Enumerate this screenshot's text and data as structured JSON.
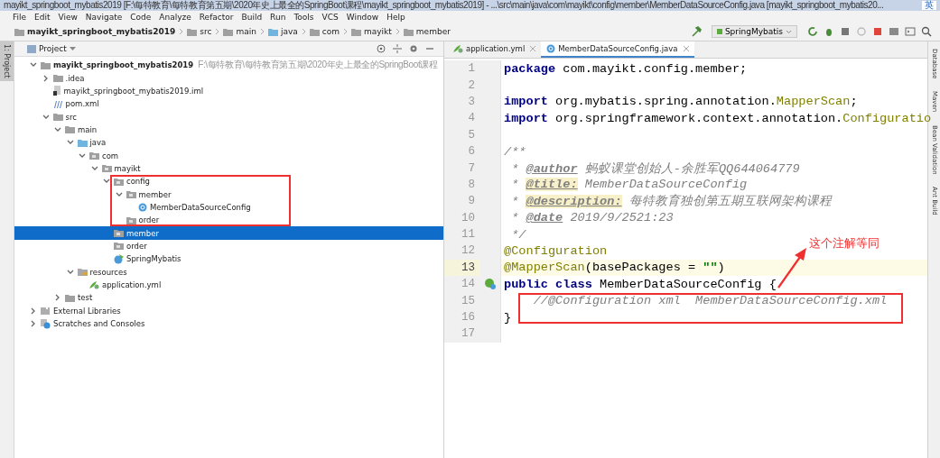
{
  "window": {
    "title": "mayikt_springboot_mybatis2019 [F:\\每特教育\\每特教育第五期\\2020年史上最全的SpringBoot课程\\mayikt_springboot_mybatis2019] - ...\\src\\main\\java\\com\\mayikt\\config\\member\\MemberDataSourceConfig.java [mayikt_springboot_mybatis20...",
    "ime": "英"
  },
  "menu": [
    "File",
    "Edit",
    "View",
    "Navigate",
    "Code",
    "Analyze",
    "Refactor",
    "Build",
    "Run",
    "Tools",
    "VCS",
    "Window",
    "Help"
  ],
  "breadcrumbs": [
    {
      "label": "mayikt_springboot_mybatis2019",
      "kind": "module"
    },
    {
      "label": "src",
      "kind": "folder"
    },
    {
      "label": "main",
      "kind": "folder"
    },
    {
      "label": "java",
      "kind": "source"
    },
    {
      "label": "com",
      "kind": "folder"
    },
    {
      "label": "mayikt",
      "kind": "folder"
    },
    {
      "label": "member",
      "kind": "folder"
    }
  ],
  "run_config": "SpringMybatis",
  "left_stripe": {
    "label": "1: Project"
  },
  "project_panel": {
    "title": "Project",
    "tree": [
      {
        "label": "mayikt_springboot_mybatis2019",
        "hint": "F:\\每特教育\\每特教育第五期\\2020年史上最全的SpringBoot课程",
        "kind": "module",
        "expanded": true,
        "selected": false,
        "children": [
          {
            "label": ".idea",
            "kind": "folder",
            "expanded": false,
            "selected": false
          },
          {
            "label": "mayikt_springboot_mybatis2019.iml",
            "kind": "iml",
            "selected": false
          },
          {
            "label": "pom.xml",
            "kind": "maven",
            "selected": false
          },
          {
            "label": "src",
            "kind": "folder",
            "expanded": true,
            "selected": false,
            "children": [
              {
                "label": "main",
                "kind": "folder",
                "expanded": true,
                "selected": false,
                "children": [
                  {
                    "label": "java",
                    "kind": "source",
                    "expanded": true,
                    "selected": false,
                    "children": [
                      {
                        "label": "com",
                        "kind": "package",
                        "expanded": true,
                        "selected": false,
                        "children": [
                          {
                            "label": "mayikt",
                            "kind": "package",
                            "expanded": true,
                            "selected": false,
                            "children": [
                              {
                                "label": "config",
                                "kind": "package",
                                "expanded": true,
                                "selected": false,
                                "children": [
                                  {
                                    "label": "member",
                                    "kind": "package",
                                    "expanded": true,
                                    "selected": false,
                                    "children": [
                                      {
                                        "label": "MemberDataSourceConfig",
                                        "kind": "class",
                                        "selected": false
                                      }
                                    ]
                                  },
                                  {
                                    "label": "order",
                                    "kind": "package",
                                    "selected": false
                                  }
                                ]
                              },
                              {
                                "label": "member",
                                "kind": "package",
                                "selected": true
                              },
                              {
                                "label": "order",
                                "kind": "package",
                                "selected": false
                              },
                              {
                                "label": "SpringMybatis",
                                "kind": "spring",
                                "selected": false
                              }
                            ]
                          }
                        ]
                      }
                    ]
                  },
                  {
                    "label": "resources",
                    "kind": "resources",
                    "expanded": true,
                    "selected": false,
                    "children": [
                      {
                        "label": "application.yml",
                        "kind": "yaml",
                        "selected": false
                      }
                    ]
                  }
                ]
              },
              {
                "label": "test",
                "kind": "folder",
                "expanded": false,
                "selected": false
              }
            ]
          }
        ]
      },
      {
        "label": "External Libraries",
        "kind": "libraries",
        "expanded": false,
        "selected": false
      },
      {
        "label": "Scratches and Consoles",
        "kind": "scratches",
        "expanded": false,
        "selected": false
      }
    ]
  },
  "editor": {
    "tabs": [
      {
        "label": "application.yml",
        "kind": "yaml",
        "selected": false
      },
      {
        "label": "MemberDataSourceConfig.java",
        "kind": "class",
        "selected": true
      }
    ],
    "lines": [
      {
        "number": "1",
        "current": false,
        "tokens": [
          {
            "t": "package",
            "kind": "keyword"
          },
          {
            "t": " com.mayikt.config.member;",
            "kind": "plain"
          }
        ]
      },
      {
        "number": "2",
        "current": false
      },
      {
        "number": "3",
        "current": false,
        "tokens": [
          {
            "t": "import",
            "kind": "keyword"
          },
          {
            "t": " org.mybatis.spring.annotation.",
            "kind": "plain"
          },
          {
            "t": "MapperScan",
            "kind": "annotation"
          },
          {
            "t": ";",
            "kind": "plain"
          }
        ]
      },
      {
        "number": "4",
        "current": false,
        "tokens": [
          {
            "t": "import",
            "kind": "keyword"
          },
          {
            "t": " org.springframework.context.annotation.",
            "kind": "plain"
          },
          {
            "t": "Configuratio",
            "kind": "annotation"
          }
        ]
      },
      {
        "number": "5",
        "current": false
      },
      {
        "number": "6",
        "current": false,
        "tokens": [
          {
            "t": "/**",
            "kind": "comment"
          }
        ]
      },
      {
        "number": "7",
        "current": false,
        "tokens": [
          {
            "t": " * ",
            "kind": "comment"
          },
          {
            "t": "@author",
            "kind": "doctag"
          },
          {
            "t": " 蚂蚁课堂创始人-余胜军QQ644064779",
            "kind": "comment"
          }
        ]
      },
      {
        "number": "8",
        "current": false,
        "tokens": [
          {
            "t": " * ",
            "kind": "comment"
          },
          {
            "t": "@title:",
            "kind": "doctag-marked"
          },
          {
            "t": " MemberDataSourceConfig",
            "kind": "comment"
          }
        ]
      },
      {
        "number": "9",
        "current": false,
        "tokens": [
          {
            "t": " * ",
            "kind": "comment"
          },
          {
            "t": "@description:",
            "kind": "doctag-marked"
          },
          {
            "t": " 每特教育独创第五期互联网架构课程",
            "kind": "comment"
          }
        ]
      },
      {
        "number": "10",
        "current": false,
        "tokens": [
          {
            "t": " * ",
            "kind": "comment"
          },
          {
            "t": "@date",
            "kind": "doctag"
          },
          {
            "t": " 2019/9/2521:23",
            "kind": "comment"
          }
        ]
      },
      {
        "number": "11",
        "current": false,
        "tokens": [
          {
            "t": " */",
            "kind": "comment"
          }
        ]
      },
      {
        "number": "12",
        "current": false,
        "tokens": [
          {
            "t": "@Configuration",
            "kind": "annotation"
          }
        ]
      },
      {
        "number": "13",
        "current": true,
        "tokens": [
          {
            "t": "@MapperScan",
            "kind": "annotation"
          },
          {
            "t": "(basePackages = ",
            "kind": "plain"
          },
          {
            "t": "\"\"",
            "kind": "string"
          },
          {
            "t": ")",
            "kind": "plain"
          }
        ]
      },
      {
        "number": "14",
        "current": false,
        "tokens": [
          {
            "t": "public class",
            "kind": "keyword"
          },
          {
            "t": " MemberDataSourceConfig {",
            "kind": "plain"
          }
        ]
      },
      {
        "number": "15",
        "current": false,
        "tokens": [
          {
            "t": "    //@Configuration xml  MemberDataSourceConfig.xml",
            "kind": "comment"
          }
        ]
      },
      {
        "number": "16",
        "current": false,
        "tokens": [
          {
            "t": "}",
            "kind": "plain"
          }
        ]
      },
      {
        "number": "17",
        "current": false
      }
    ]
  },
  "right_stripe": [
    "Database",
    "Maven",
    "Bean Validation",
    "Ant Build"
  ],
  "annotation": {
    "text": "这个注解等同"
  }
}
